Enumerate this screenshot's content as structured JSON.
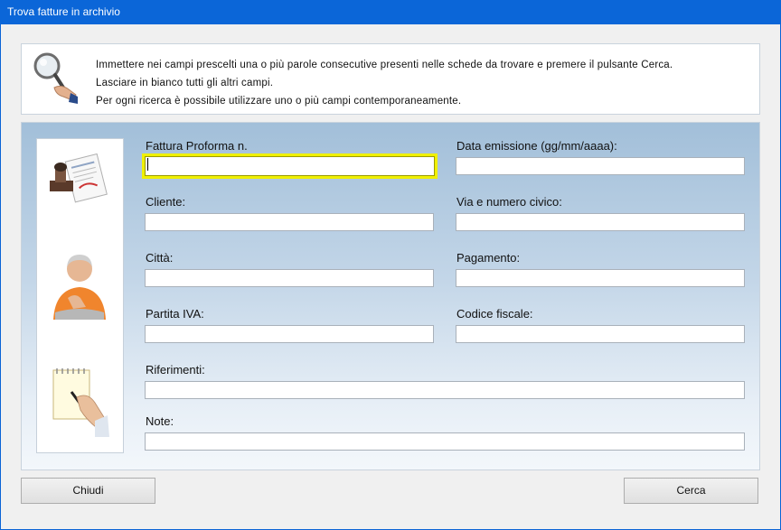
{
  "window": {
    "title": "Trova fatture in archivio"
  },
  "info": {
    "lines": [
      "Immettere nei campi prescelti una o più parole consecutive presenti nelle schede da trovare e premere il pulsante Cerca.",
      "Lasciare in bianco tutti gli altri campi.",
      "Per ogni ricerca è possibile utilizzare uno o più campi contemporaneamente."
    ]
  },
  "form": {
    "fattura_label": "Fattura Proforma n.",
    "fattura_value": "",
    "data_label": "Data emissione (gg/mm/aaaa):",
    "data_value": "",
    "cliente_label": "Cliente:",
    "cliente_value": "",
    "via_label": "Via e numero civico:",
    "via_value": "",
    "citta_label": "Città:",
    "citta_value": "",
    "pagamento_label": "Pagamento:",
    "pagamento_value": "",
    "piva_label": "Partita IVA:",
    "piva_value": "",
    "cf_label": "Codice fiscale:",
    "cf_value": "",
    "riferimenti_label": "Riferimenti:",
    "riferimenti_value": "",
    "note_label": "Note:",
    "note_value": ""
  },
  "buttons": {
    "chiudi": "Chiudi",
    "cerca": "Cerca"
  }
}
